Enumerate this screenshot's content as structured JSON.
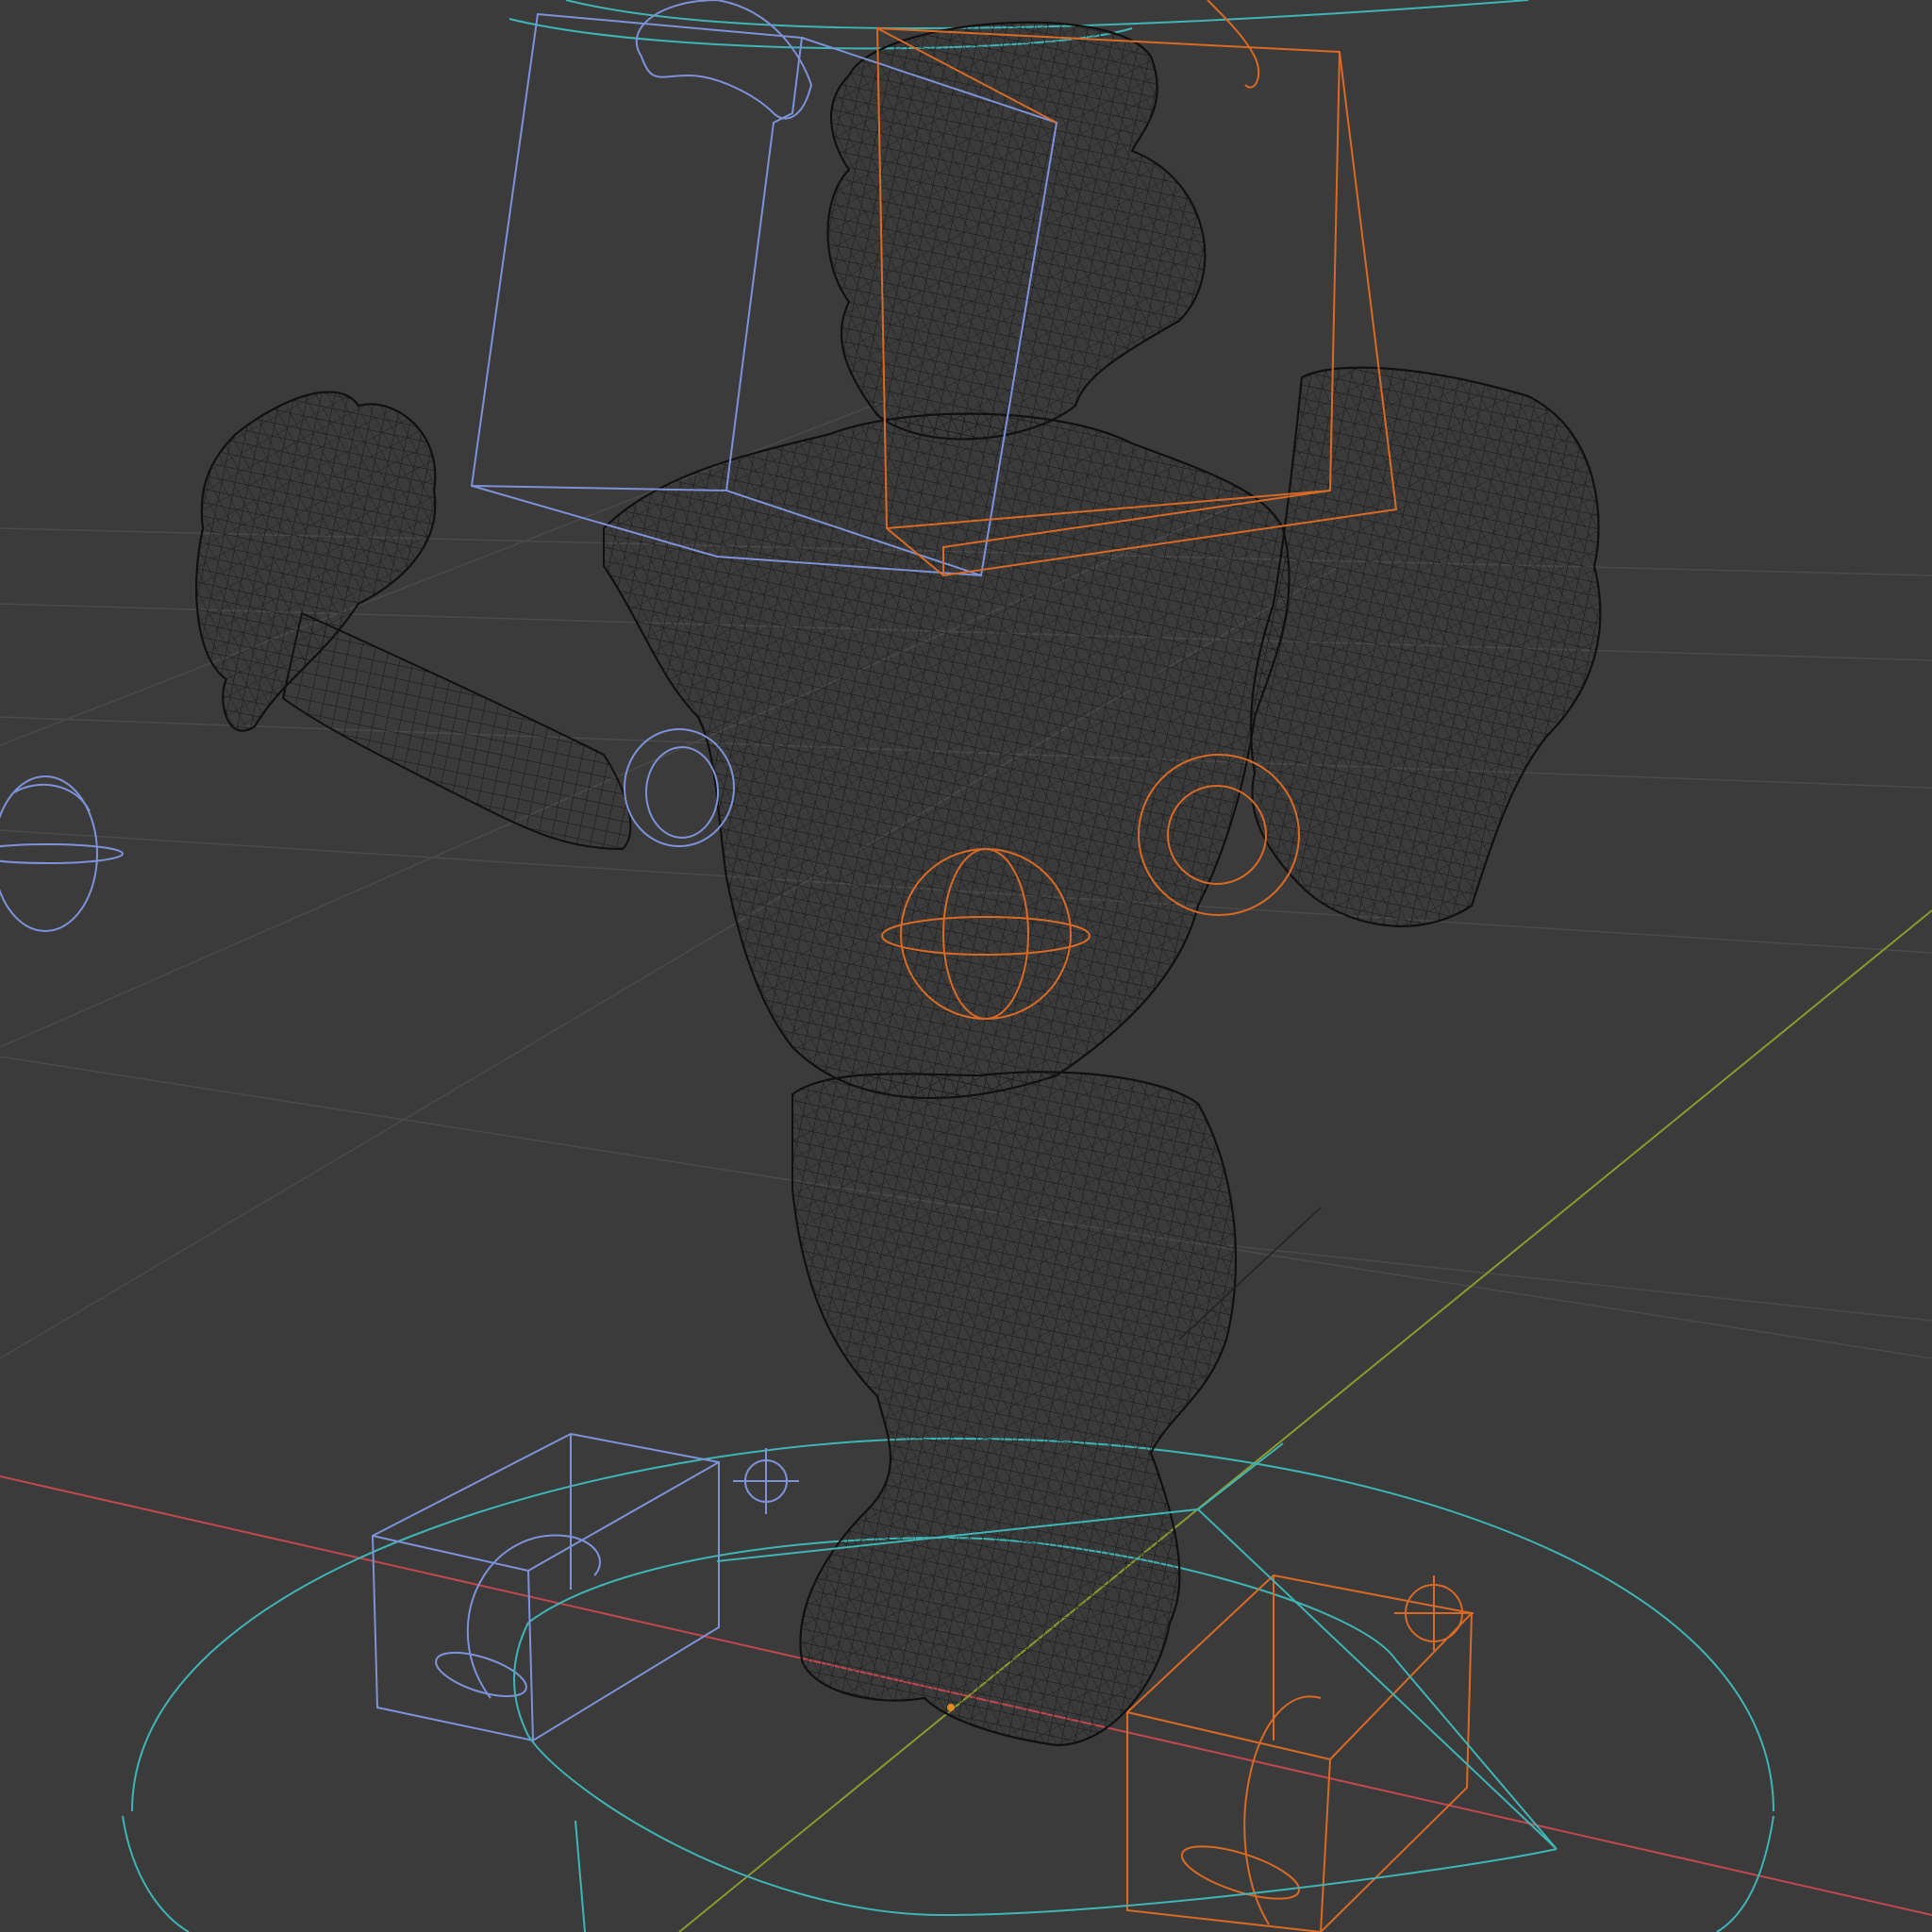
{
  "viewport": {
    "mode": "wireframe",
    "background": "#3b3b3b"
  },
  "colors": {
    "floor_grid": "#4a4a4a",
    "x_axis": "#c2484f",
    "y_axis": "#8a9a2e",
    "mesh_wire": "#141414",
    "rig_left": "#7e92d8",
    "rig_right": "#d86a26",
    "rig_root": "#3fb5b5"
  },
  "scene": {
    "objects": [
      {
        "id": "character-mesh",
        "icon": "mesh-icon"
      },
      {
        "id": "head-control",
        "icon": "cube-outline-icon"
      },
      {
        "id": "hand-left-control",
        "icon": "cube-outline-icon"
      },
      {
        "id": "hand-right-control",
        "icon": "cube-outline-icon"
      },
      {
        "id": "foot-left-control",
        "icon": "cube-outline-icon"
      },
      {
        "id": "foot-right-control",
        "icon": "cube-outline-icon"
      },
      {
        "id": "elbow-left-pole",
        "icon": "circle-icon"
      },
      {
        "id": "elbow-right-pole",
        "icon": "circle-icon"
      },
      {
        "id": "hip-control",
        "icon": "sphere-icon"
      },
      {
        "id": "root-control",
        "icon": "ring-icon"
      },
      {
        "id": "knee-left-target",
        "icon": "crosshair-icon"
      },
      {
        "id": "knee-right-target",
        "icon": "crosshair-icon"
      }
    ]
  }
}
